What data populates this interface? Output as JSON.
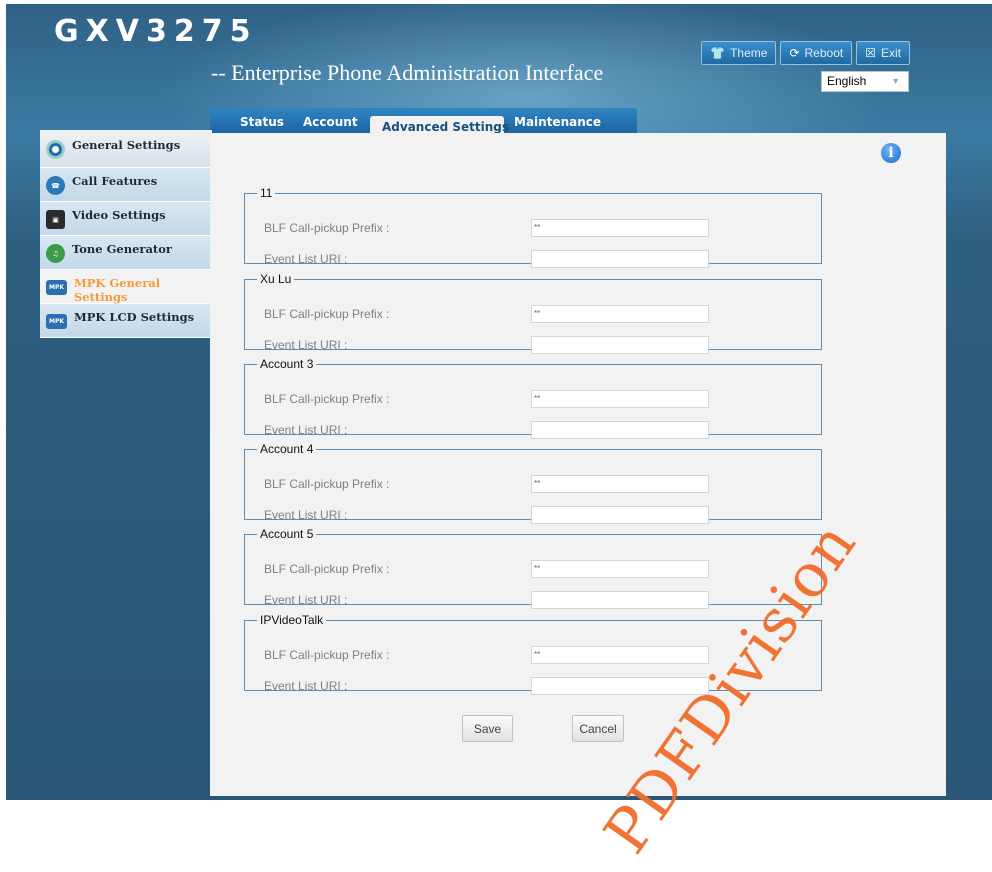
{
  "app": {
    "logo": "GXV3275",
    "subtitle": "-- Enterprise Phone Administration Interface"
  },
  "top_buttons": [
    {
      "label": "Theme",
      "icon": "tshirt-icon"
    },
    {
      "label": "Reboot",
      "icon": "reboot-icon"
    },
    {
      "label": "Exit",
      "icon": "exit-icon"
    }
  ],
  "language": {
    "selected": "English"
  },
  "tabs": [
    {
      "label": "Status",
      "active": false
    },
    {
      "label": "Account",
      "active": false
    },
    {
      "label": "Advanced Settings",
      "active": true
    },
    {
      "label": "Maintenance",
      "active": false
    }
  ],
  "sidebar": {
    "items": [
      {
        "label": "General Settings",
        "icon": "gear-icon",
        "selected": false
      },
      {
        "label": "Call Features",
        "icon": "phone-icon",
        "selected": false
      },
      {
        "label": "Video Settings",
        "icon": "video-icon",
        "selected": false
      },
      {
        "label": "Tone Generator",
        "icon": "music-note-icon",
        "selected": false
      },
      {
        "label": "MPK General Settings",
        "icon": "mpk-icon",
        "selected": true
      },
      {
        "label": "MPK LCD Settings",
        "icon": "mpk-icon",
        "selected": false
      }
    ]
  },
  "form": {
    "prefix_label": "BLF Call-pickup Prefix :",
    "uri_label": "Event List URI :",
    "groups": [
      {
        "title": "11",
        "prefix": "**",
        "uri": ""
      },
      {
        "title": "Xu Lu",
        "prefix": "**",
        "uri": ""
      },
      {
        "title": "Account 3",
        "prefix": "**",
        "uri": ""
      },
      {
        "title": "Account 4",
        "prefix": "**",
        "uri": ""
      },
      {
        "title": "Account 5",
        "prefix": "**",
        "uri": ""
      },
      {
        "title": "IPVideoTalk",
        "prefix": "**",
        "uri": ""
      }
    ]
  },
  "actions": {
    "save_label": "Save",
    "cancel_label": "Cancel"
  },
  "info_glyph": "i",
  "watermark": "PDFDivision",
  "colors": {
    "accent": "#1f6aa3",
    "selected_item": "#f39b3c",
    "watermark": "#f06d2b"
  }
}
